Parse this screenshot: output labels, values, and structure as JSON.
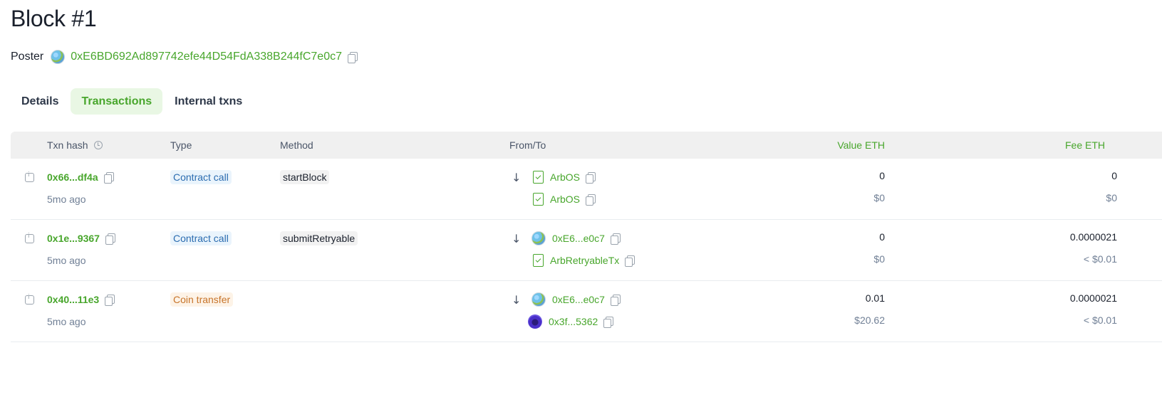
{
  "page": {
    "title": "Block #1"
  },
  "poster": {
    "label": "Poster",
    "address": "0xE6BD692Ad897742efe44D54FdA338B244fC7e0c7"
  },
  "tabs": [
    {
      "label": "Details",
      "active": false
    },
    {
      "label": "Transactions",
      "active": true
    },
    {
      "label": "Internal txns",
      "active": false
    }
  ],
  "table": {
    "headers": {
      "txn_hash": "Txn hash",
      "type": "Type",
      "method": "Method",
      "from_to": "From/To",
      "value": "Value ETH",
      "fee": "Fee ETH"
    },
    "rows": [
      {
        "hash": "0x66...df4a",
        "age": "5mo ago",
        "type": "Contract call",
        "type_color": "blue",
        "method": "startBlock",
        "from": {
          "label": "ArbOS",
          "icon": "contract-icon"
        },
        "to": {
          "label": "ArbOS",
          "icon": "contract-icon"
        },
        "value": "0",
        "value_usd": "$0",
        "fee": "0",
        "fee_usd": "$0"
      },
      {
        "hash": "0x1e...9367",
        "age": "5mo ago",
        "type": "Contract call",
        "type_color": "blue",
        "method": "submitRetryable",
        "from": {
          "label": "0xE6...e0c7",
          "icon": "globe-avatar"
        },
        "to": {
          "label": "ArbRetryableTx",
          "icon": "contract-icon"
        },
        "value": "0",
        "value_usd": "$0",
        "fee": "0.0000021",
        "fee_usd": "< $0.01"
      },
      {
        "hash": "0x40...11e3",
        "age": "5mo ago",
        "type": "Coin transfer",
        "type_color": "orange",
        "method": "",
        "from": {
          "label": "0xE6...e0c7",
          "icon": "globe-avatar"
        },
        "to": {
          "label": "0x3f...5362",
          "icon": "purple-avatar"
        },
        "value": "0.01",
        "value_usd": "$20.62",
        "fee": "0.0000021",
        "fee_usd": "< $0.01"
      }
    ]
  },
  "colors": {
    "accent": "#48a62c",
    "active_tab_bg": "#e9f7e4",
    "header_bg": "#f0f0f0"
  }
}
